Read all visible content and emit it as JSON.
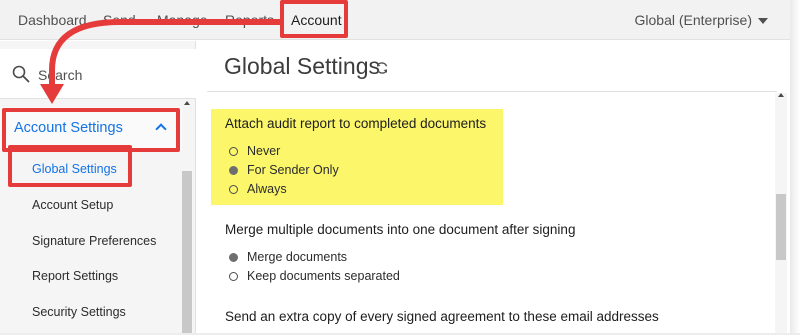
{
  "nav": {
    "items": [
      "Dashboard",
      "Send",
      "Manage",
      "Reports",
      "Account"
    ],
    "account_menu": "Global (Enterprise)"
  },
  "sidebar": {
    "search_label": "Search",
    "section_label": "Account Settings",
    "items": [
      "Global Settings",
      "Account Setup",
      "Signature Preferences",
      "Report Settings",
      "Security Settings"
    ]
  },
  "main": {
    "title": "Global Settings",
    "sections": [
      {
        "title": "Attach audit report to completed documents",
        "options": [
          {
            "label": "Never",
            "selected": false
          },
          {
            "label": "For Sender Only",
            "selected": true
          },
          {
            "label": "Always",
            "selected": false
          }
        ]
      },
      {
        "title": "Merge multiple documents into one document after signing",
        "options": [
          {
            "label": "Merge documents",
            "selected": true
          },
          {
            "label": "Keep documents separated",
            "selected": false
          }
        ]
      },
      {
        "title": "Send an extra copy of every signed agreement to these email addresses",
        "options": []
      }
    ]
  },
  "colors": {
    "accent": "#1473e6",
    "annotation": "#e53b3b",
    "highlight": "#fbf66a"
  },
  "icons": {
    "search": "search-icon",
    "refresh": "refresh-icon",
    "chevron": "chevron-up-icon",
    "caret": "caret-down-icon"
  }
}
